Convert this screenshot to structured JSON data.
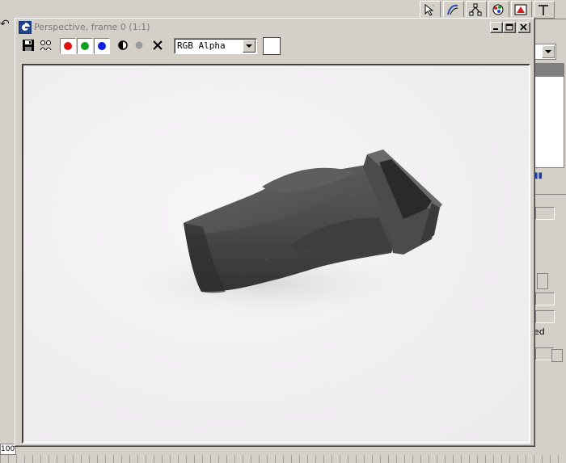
{
  "window": {
    "title": "Perspective, frame 0 (1:1)"
  },
  "toolbar": {
    "save": "save-icon",
    "clone": "clone-icon",
    "channels": [
      {
        "name": "red",
        "color": "#e01010"
      },
      {
        "name": "green",
        "color": "#10a020"
      },
      {
        "name": "blue",
        "color": "#1020e0"
      }
    ],
    "mono": "monochrome-icon",
    "clear": "clear-icon",
    "channel_select": "RGB Alpha",
    "swatch_color": "#ffffff"
  },
  "background_app": {
    "status_counter": "100",
    "panel_text": "ed"
  },
  "colors": {
    "panel": "#d4d0c8",
    "canvas": "#f2f1f2",
    "object": "#4a4a4a"
  }
}
